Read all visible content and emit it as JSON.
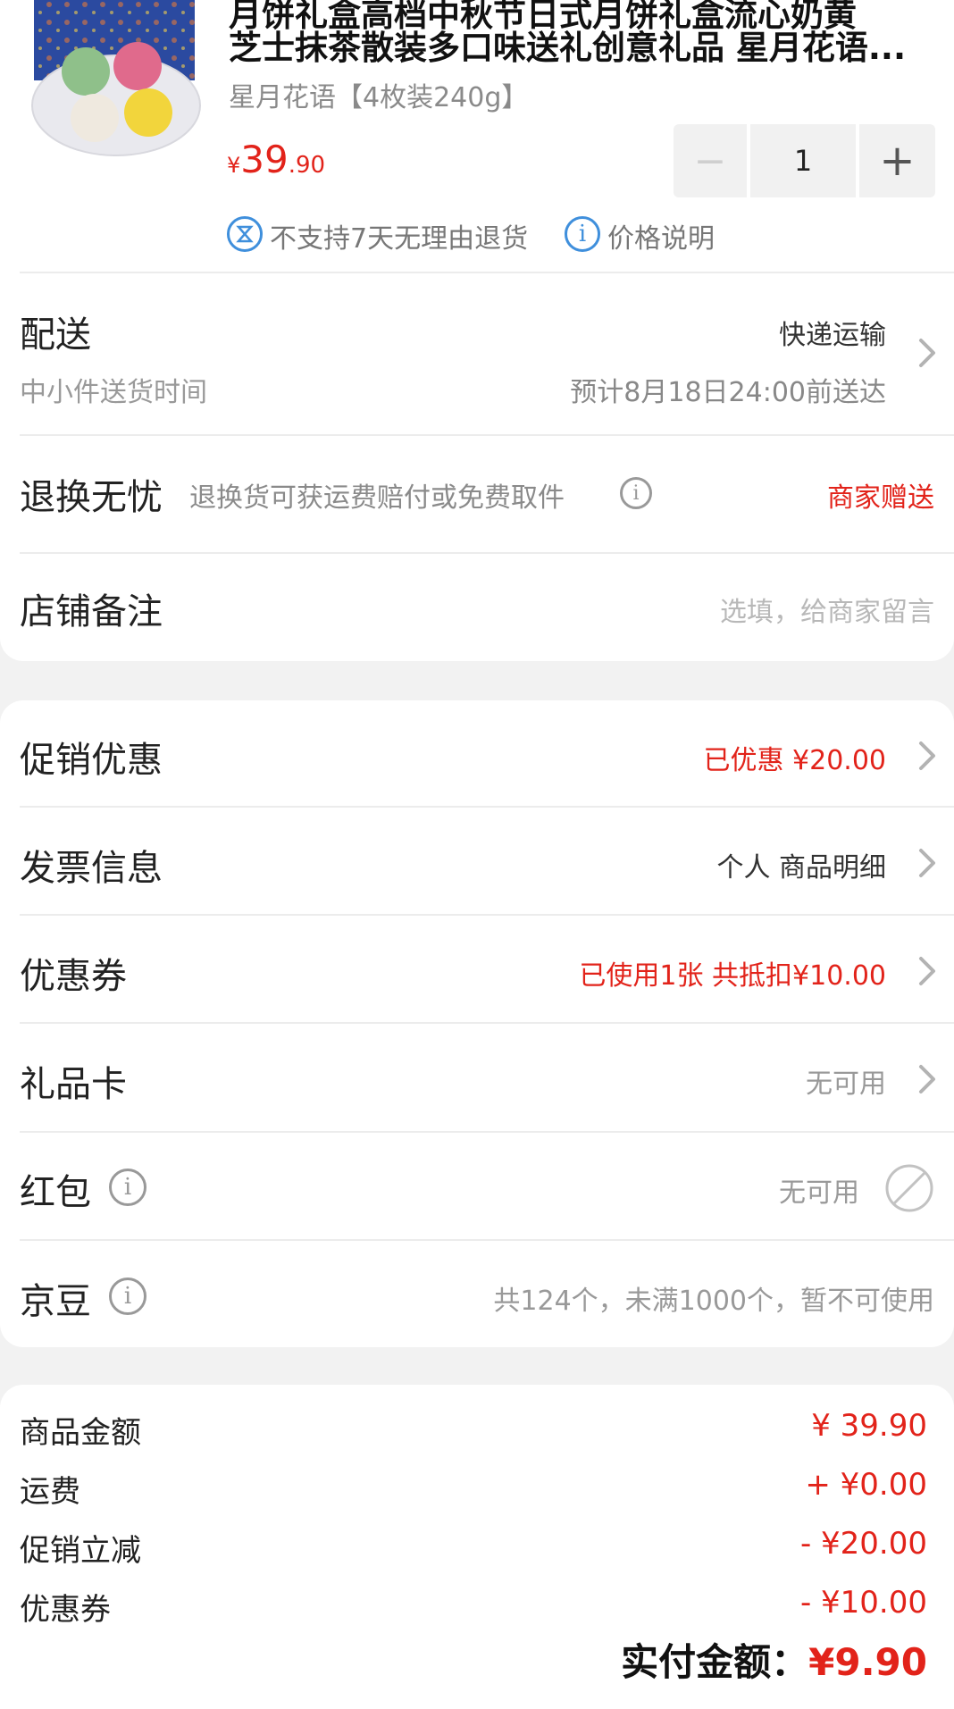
{
  "product": {
    "title_line1": "月饼礼盒高档中秋节日式月饼礼盒流心奶黄",
    "title_line2": "芝士抹茶散装多口味送礼创意礼品 星月花语...",
    "spec": "星月花语【4枚装240g】",
    "price_currency": "¥",
    "price_int": "39",
    "price_dec": ".90",
    "quantity": "1",
    "no_return": "不支持7天无理由退货",
    "price_note": "价格说明"
  },
  "delivery": {
    "label": "配送",
    "method": "快递运输",
    "sub_label": "中小件送货时间",
    "eta": "预计8月18日24:00前送达"
  },
  "returns": {
    "label": "退换无忧",
    "desc": "退换货可获运费赔付或免费取件",
    "value": "商家赠送"
  },
  "remark": {
    "label": "店铺备注",
    "placeholder": "选填，给商家留言"
  },
  "rows": {
    "promo_label": "促销优惠",
    "promo_value": "已优惠 ¥20.00",
    "invoice_label": "发票信息",
    "invoice_value": "个人 商品明细",
    "coupon_label": "优惠券",
    "coupon_value": "已使用1张 共抵扣¥10.00",
    "giftcard_label": "礼品卡",
    "giftcard_value": "无可用",
    "redpacket_label": "红包",
    "redpacket_value": "无可用",
    "jingdou_label": "京豆",
    "jingdou_value": "共124个，未满1000个，暂不可使用"
  },
  "summary": {
    "goods_label": "商品金额",
    "goods_value": "¥ 39.90",
    "shipping_label": "运费",
    "shipping_value": "+ ¥0.00",
    "promo_label": "促销立减",
    "promo_value": "- ¥20.00",
    "coupon_label": "优惠券",
    "coupon_value": "- ¥10.00",
    "final_label": "实付金额：",
    "final_value": "¥9.90"
  },
  "colors": {
    "accent": "#e2231a",
    "info": "#3f8fdc"
  }
}
